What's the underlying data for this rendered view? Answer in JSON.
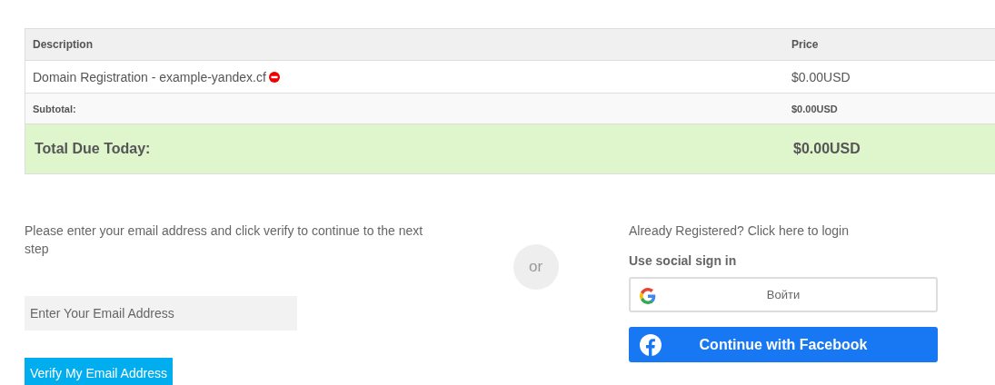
{
  "cart_table": {
    "columns": [
      "Description",
      "Price"
    ],
    "rows": [
      {
        "kind": "item",
        "description": "Domain Registration - example-yandex.cf",
        "price": "$0.00USD",
        "removable": true
      },
      {
        "kind": "subtotal",
        "description": "Subtotal:",
        "price": "$0.00USD"
      },
      {
        "kind": "total",
        "description": "Total Due Today:",
        "price": "$0.00USD"
      }
    ]
  },
  "verify_section": {
    "instructions": "Please enter your email address and click verify to continue to the next step",
    "email_field": {
      "placeholder": "Enter Your Email Address"
    },
    "verify_button": "Verify My Email Address"
  },
  "separator": "or",
  "login_section": {
    "login_link": "Already Registered? Click here to login",
    "social_heading": "Use social sign in",
    "google_button": "Войти",
    "facebook_button": "Continue with Facebook"
  }
}
